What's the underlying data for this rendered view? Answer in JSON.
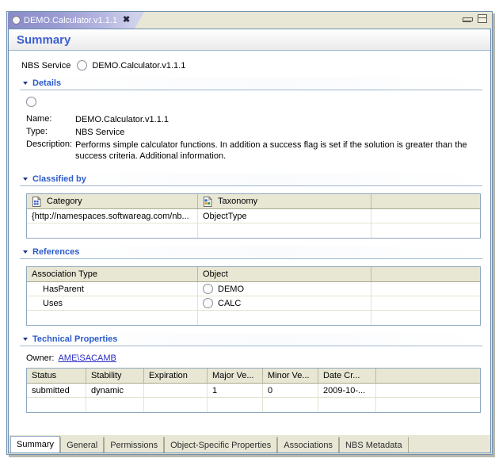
{
  "window": {
    "tab_title": "DEMO.Calculator.v1.1.1",
    "tab_close": "✖",
    "minimize_label": "minimize",
    "maximize_label": "maximize"
  },
  "form": {
    "title": "Summary",
    "top_label": "NBS Service",
    "top_value": "DEMO.Calculator.v1.1.1"
  },
  "sections": {
    "details": {
      "title": "Details",
      "rows": [
        {
          "key": "Name:",
          "value": "DEMO.Calculator.v1.1.1"
        },
        {
          "key": "Type:",
          "value": "NBS Service"
        },
        {
          "key": "Description:",
          "value": "Performs simple calculator functions. In addition a success flag is set if the solution is greater than the success criteria. Additional information."
        }
      ]
    },
    "classified_by": {
      "title": "Classified by",
      "columns": [
        "Category",
        "Taxonomy",
        ""
      ],
      "column_icons": [
        "category-icon",
        "taxonomy-icon",
        ""
      ],
      "rows": [
        [
          "{http://namespaces.softwareag.com/nb...",
          "ObjectType",
          ""
        ],
        [
          "",
          "",
          ""
        ]
      ]
    },
    "references": {
      "title": "References",
      "columns": [
        "Association Type",
        "Object",
        ""
      ],
      "rows": [
        {
          "association_type": "HasParent",
          "object": "DEMO"
        },
        {
          "association_type": "Uses",
          "object": "CALC"
        },
        {
          "association_type": "",
          "object": ""
        }
      ]
    },
    "technical_properties": {
      "title": "Technical Properties",
      "owner_label": "Owner:",
      "owner_value": "AME\\SACAMB",
      "columns": [
        "Status",
        "Stability",
        "Expiration",
        "Major Ve...",
        "Minor Ve...",
        "Date Cr...",
        ""
      ],
      "rows": [
        [
          "submitted",
          "dynamic",
          "",
          "1",
          "0",
          "2009-10-...",
          ""
        ],
        [
          "",
          "",
          "",
          "",
          "",
          "",
          ""
        ]
      ]
    }
  },
  "bottom_tabs": [
    {
      "label": "Summary",
      "active": true
    },
    {
      "label": "General",
      "active": false
    },
    {
      "label": "Permissions",
      "active": false
    },
    {
      "label": "Object-Specific Properties",
      "active": false
    },
    {
      "label": "Associations",
      "active": false
    },
    {
      "label": "NBS Metadata",
      "active": false
    }
  ],
  "colors": {
    "accent_blue": "#2b5bcb",
    "header_beige": "#e8e7d4",
    "border_blue": "#6f8fb0",
    "link_blue": "#2b2bc8"
  }
}
